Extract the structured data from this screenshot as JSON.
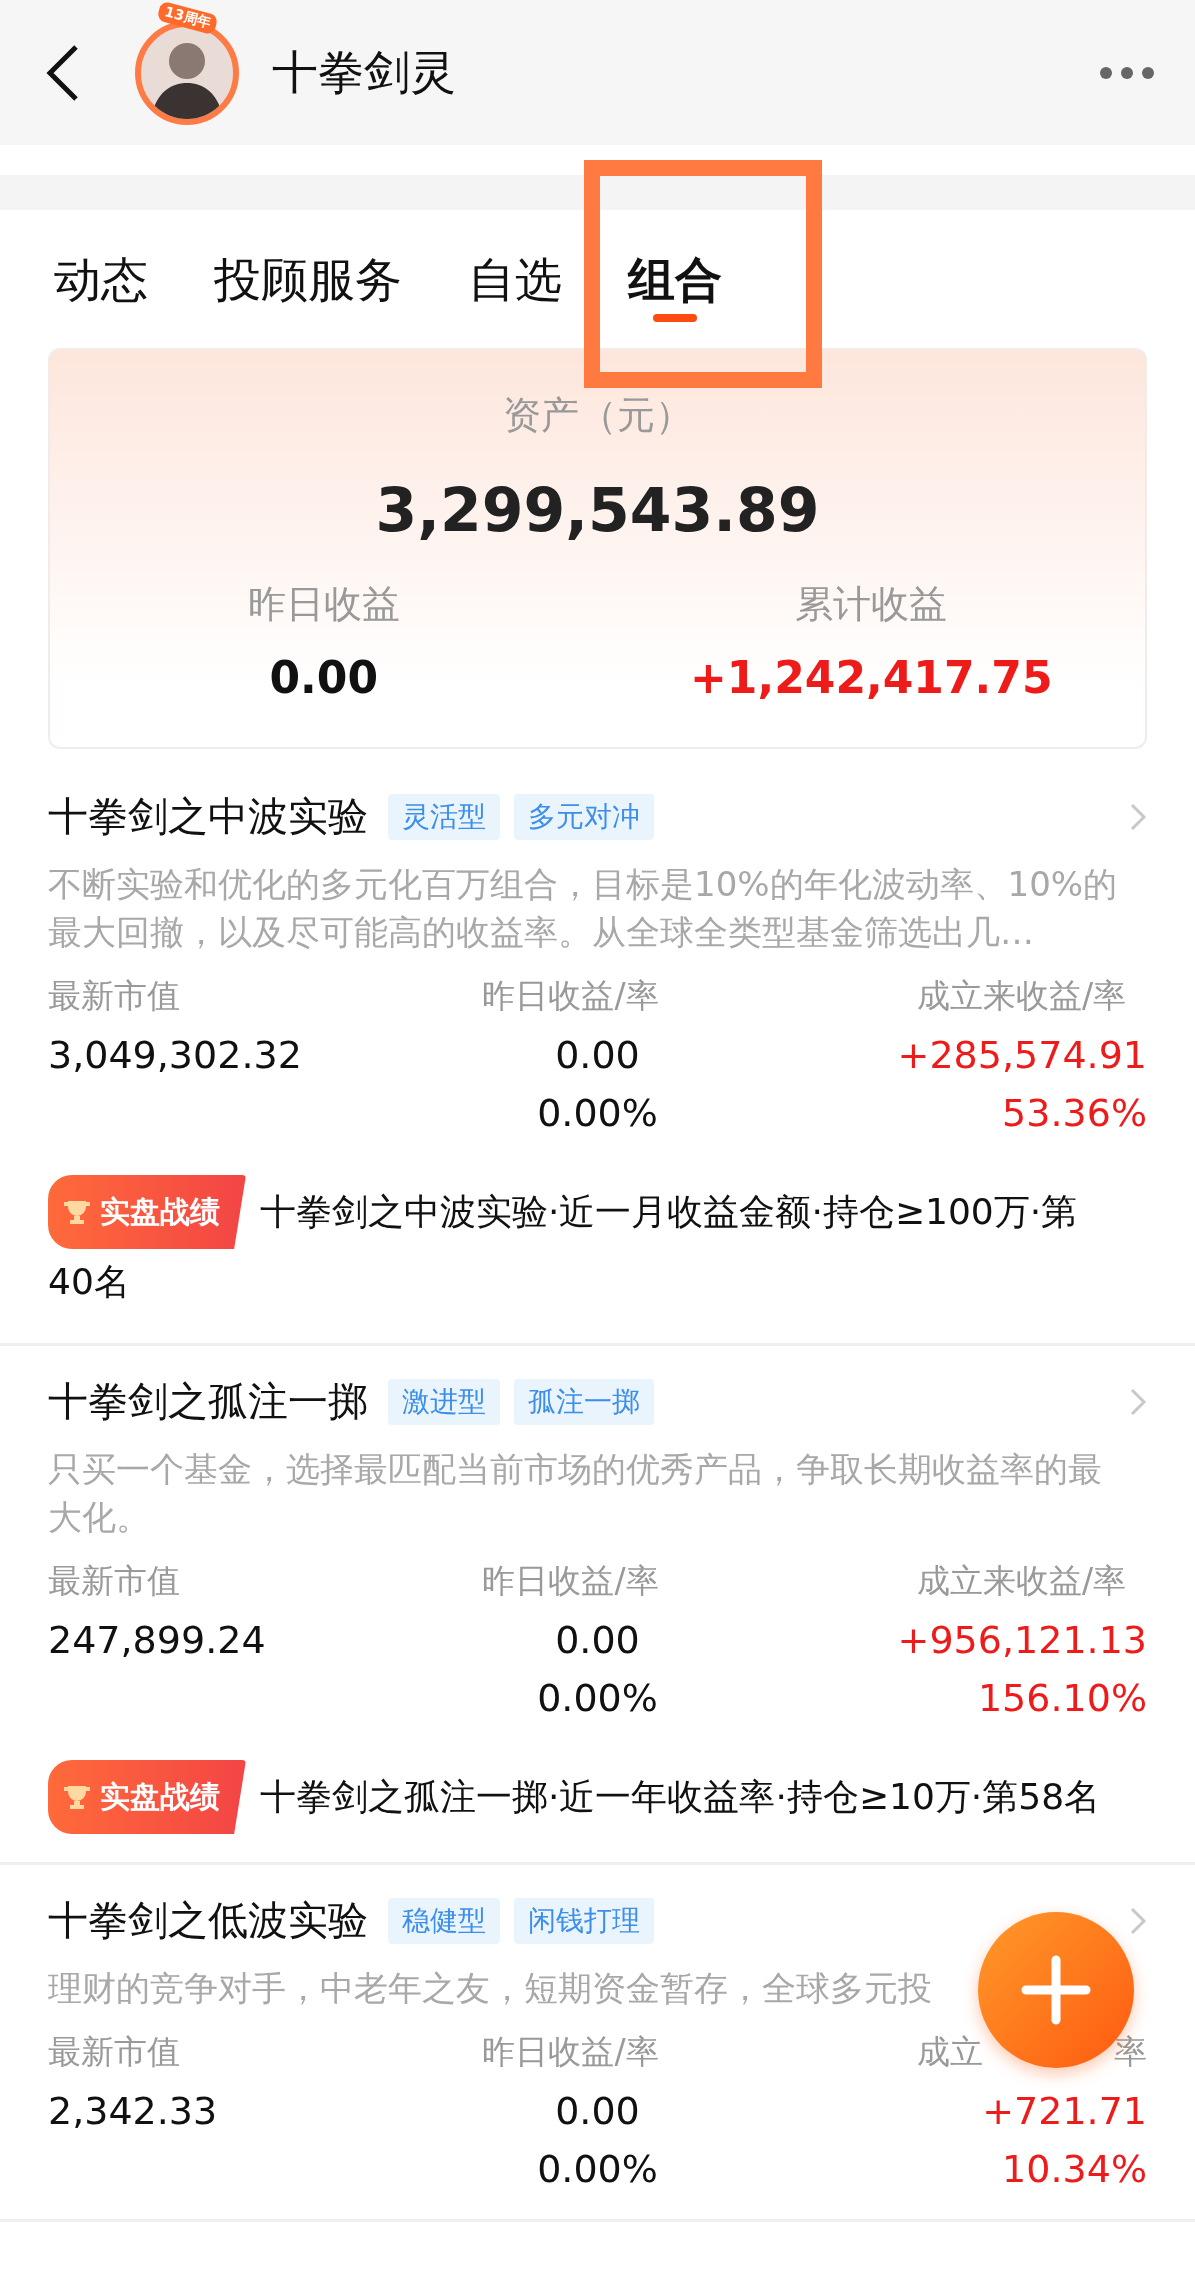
{
  "header": {
    "title": "十拳剑灵",
    "avatar_badge": "13周年"
  },
  "tabs": [
    {
      "label": "动态",
      "selected": false
    },
    {
      "label": "投顾服务",
      "selected": false
    },
    {
      "label": "自选",
      "selected": false
    },
    {
      "label": "组合",
      "selected": true,
      "highlighted": true
    }
  ],
  "summary": {
    "label": "资产（元）",
    "value": "3,299,543.89",
    "stats": [
      {
        "label": "昨日收益",
        "value": "0.00",
        "positive": false
      },
      {
        "label": "累计收益",
        "value": "+1,242,417.75",
        "positive": true
      }
    ]
  },
  "portfolios": [
    {
      "name": "十拳剑之中波实验",
      "tags": [
        "灵活型",
        "多元对冲"
      ],
      "description": "不断实验和优化的多元化百万组合，目标是10%的年化波动率、10%的最大回撤，以及尽可能高的收益率。从全球全类型基金筛选出几…",
      "market_value_label": "最新市值",
      "market_value": "3,049,302.32",
      "yesterday_label": [
        "昨日收益/率"
      ],
      "yesterday_value": "0.00",
      "yesterday_rate": "0.00%",
      "total_label": [
        "成立来收益/率"
      ],
      "total_value": "+285,574.91",
      "total_rate": "53.36%",
      "total_positive": true,
      "badge": "实盘战绩",
      "ranking": [
        "十拳剑之中波实验·近一月收益金额·持仓≥100万·第",
        "40名"
      ]
    },
    {
      "name": "十拳剑之孤注一掷",
      "tags": [
        "激进型",
        "孤注一掷"
      ],
      "description": "只买一个基金，选择最匹配当前市场的优秀产品，争取长期收益率的最大化。",
      "market_value_label": "最新市值",
      "market_value": "247,899.24",
      "yesterday_label": [
        "昨日收益/率"
      ],
      "yesterday_value": "0.00",
      "yesterday_rate": "0.00%",
      "total_label": [
        "成立来收益/率"
      ],
      "total_value": "+956,121.13",
      "total_rate": "156.10%",
      "total_positive": true,
      "badge": "实盘战绩",
      "ranking": [
        "十拳剑之孤注一掷·近一年收益率·持仓≥10万·第58名"
      ]
    },
    {
      "name": "十拳剑之低波实验",
      "tags": [
        "稳健型",
        "闲钱打理"
      ],
      "description": "理财的竞争对手，中老年之友，短期资金暂存，全球多元投",
      "market_value_label": "最新市值",
      "market_value": "2,342.33",
      "yesterday_label": [
        "昨日收益/率"
      ],
      "yesterday_value": "0.00",
      "yesterday_rate": "0.00%",
      "total_label": [
        "成立",
        "率"
      ],
      "total_value": "+721.71",
      "total_rate": "10.34%",
      "total_positive": true
    }
  ],
  "fab": {
    "kind": "add"
  }
}
